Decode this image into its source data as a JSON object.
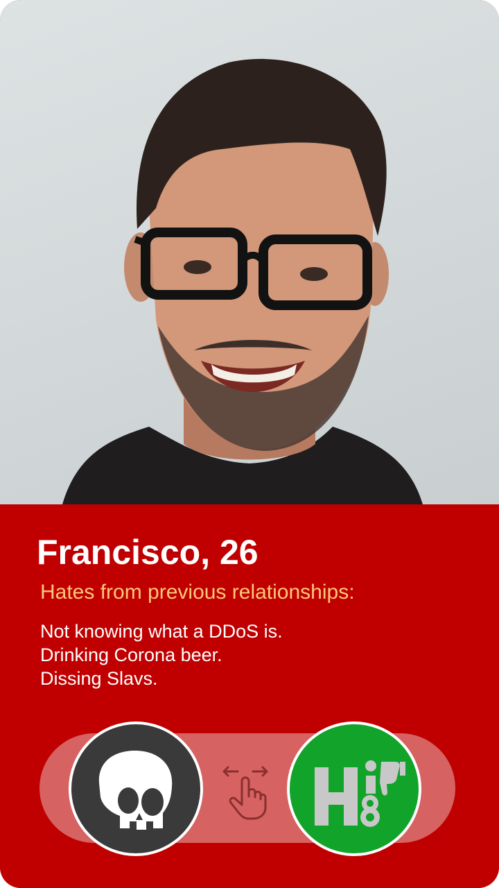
{
  "profile": {
    "name_age": "Francisco, 26",
    "photo_icon": "profile-photo",
    "hates_heading": "Hates from previous relationships:",
    "hates": [
      "Not knowing what a DDoS is.",
      "Drinking Corona beer.",
      "Dissing Slavs."
    ]
  },
  "actions": {
    "pass_icon": "skull-icon",
    "swipe_icon": "swipe-hand-icon",
    "hate_icon": "h8-thumbs-down-icon",
    "hate_logo_text": "H8"
  },
  "colors": {
    "card_background": "#c00000",
    "heading_accent": "#fcc87a",
    "track": "#d76262",
    "pass_button": "#3a3a3a",
    "hate_button": "#11a32a"
  }
}
